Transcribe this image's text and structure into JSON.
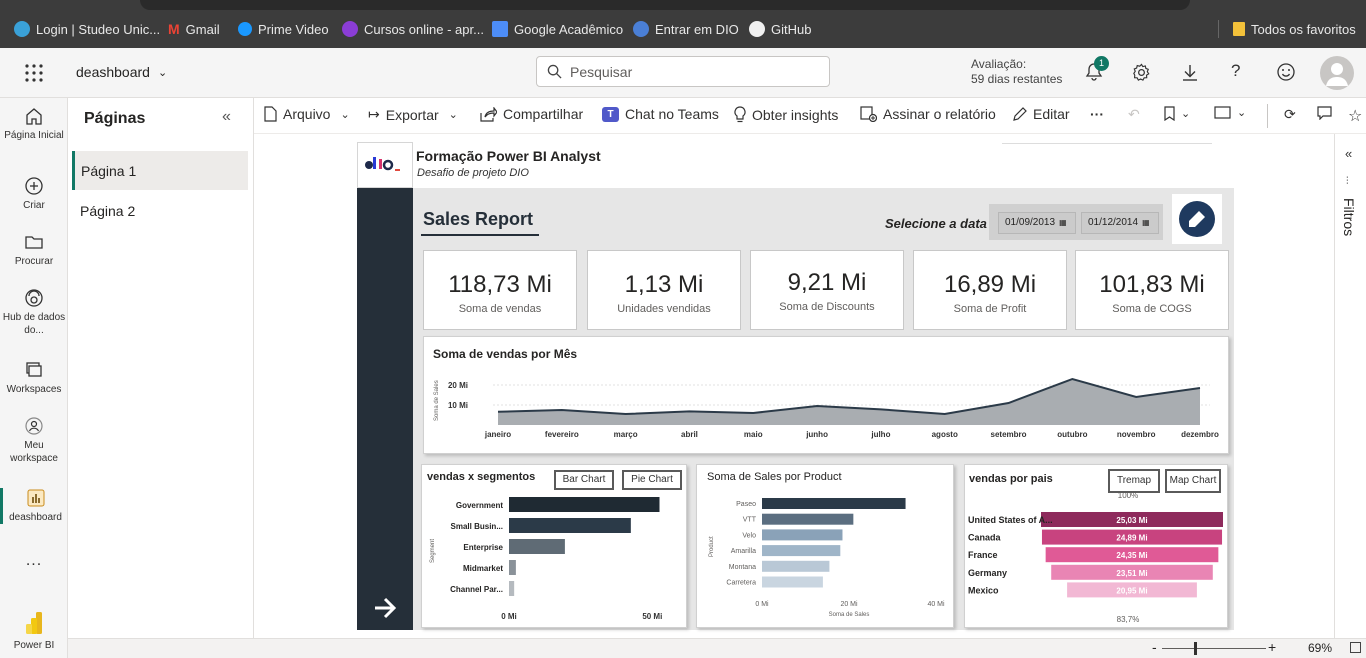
{
  "bookmarks": {
    "items": [
      "Login | Studeo Unic...",
      "Gmail",
      "Prime Video",
      "Cursos online - apr...",
      "Google Acadêmico",
      "Entrar em DIO",
      "GitHub"
    ],
    "favorites": "Todos os favoritos"
  },
  "header": {
    "report_name": "deashboard",
    "search_placeholder": "Pesquisar",
    "trial_line1": "Avaliação:",
    "trial_line2": "59 dias restantes",
    "notif_count": "1"
  },
  "nav": {
    "items": [
      "Página Inicial",
      "Criar",
      "Procurar",
      "Hub de dados do...",
      "Workspaces",
      "Meu workspace",
      "deashboard"
    ],
    "more": "...",
    "brand": "Power BI"
  },
  "pages": {
    "title": "Páginas",
    "items": [
      "Página 1",
      "Página 2"
    ]
  },
  "toolbar": {
    "arquivo": "Arquivo",
    "exportar": "Exportar",
    "compartilhar": "Compartilhar",
    "chat": "Chat no Teams",
    "insights": "Obter insights",
    "assinar": "Assinar o relatório",
    "editar": "Editar",
    "more": "···"
  },
  "filters": {
    "label": "Filtros"
  },
  "status": {
    "zoom": "69%",
    "minus": "-",
    "plus": "+"
  },
  "report": {
    "brand_title": "Formação Power BI Analyst",
    "brand_subtitle": "Desafio de projeto DIO",
    "title": "Sales Report",
    "date_label": "Selecione a data",
    "date_start": "01/09/2013",
    "date_end": "01/12/2014",
    "kpis": [
      {
        "value": "118,73 Mi",
        "label": "Soma de vendas"
      },
      {
        "value": "1,13 Mi",
        "label": "Unidades vendidas"
      },
      {
        "value": "9,21 Mi",
        "label": "Soma de Discounts"
      },
      {
        "value": "16,89 Mi",
        "label": "Soma de Profit"
      },
      {
        "value": "101,83 Mi",
        "label": "Soma de COGS"
      }
    ],
    "segments": {
      "bar_btn": "Bar Chart",
      "pie_btn": "Pie Chart"
    },
    "country": {
      "treemap_btn": "Tremap",
      "map_btn": "Map Chart"
    }
  },
  "chart_data": [
    {
      "type": "area",
      "title": "Soma de vendas por Mês",
      "ylabel": "Soma de Sales",
      "ytick_labels": [
        "10 Mi",
        "20 Mi"
      ],
      "ylim": [
        0,
        30
      ],
      "categories": [
        "janeiro",
        "fevereiro",
        "março",
        "abril",
        "maio",
        "junho",
        "julho",
        "agosto",
        "setembro",
        "outubro",
        "novembro",
        "dezembro"
      ],
      "values": [
        6.6,
        7.5,
        5.5,
        6.8,
        6.0,
        9.5,
        7.8,
        5.5,
        11.0,
        23.0,
        14.0,
        18.5
      ],
      "grid": true,
      "color": "#a9adb1",
      "line_color": "#2b3a48"
    },
    {
      "type": "bar",
      "orientation": "horizontal",
      "title": "vendas x segmentos",
      "ylabel": "Segment",
      "xtick_labels": [
        "0 Mi",
        "50 Mi"
      ],
      "xlim": [
        0,
        60
      ],
      "categories": [
        "Government",
        "Small Busin...",
        "Enterprise",
        "Midmarket",
        "Channel Par..."
      ],
      "values": [
        52.5,
        42.5,
        19.5,
        2.4,
        1.8
      ],
      "colors": [
        "#1f2a33",
        "#2b3a48",
        "#5f6b75",
        "#8a9299",
        "#b5babf"
      ]
    },
    {
      "type": "bar",
      "orientation": "horizontal",
      "title": "Soma de Sales por Product",
      "ylabel": "Product",
      "xlabel": "Soma de Sales",
      "xtick_labels": [
        "0 Mi",
        "20 Mi",
        "40 Mi"
      ],
      "xlim": [
        0,
        40
      ],
      "categories": [
        "Paseo",
        "VTT",
        "Velo",
        "Amarilla",
        "Montana",
        "Carretera"
      ],
      "values": [
        33.0,
        21.0,
        18.5,
        18.0,
        15.5,
        14.0
      ],
      "colors": [
        "#2b3a48",
        "#5b6e80",
        "#8aa2b8",
        "#9fb5c8",
        "#b9c8d6",
        "#c9d5e0"
      ]
    },
    {
      "type": "bar",
      "orientation": "funnel",
      "title": "vendas por pais",
      "categories": [
        "United States of A...",
        "Canada",
        "France",
        "Germany",
        "Mexico"
      ],
      "values": [
        25.03,
        24.89,
        24.35,
        23.51,
        20.95
      ],
      "value_labels": [
        "25,03 Mi",
        "24,89 Mi",
        "24,35 Mi",
        "23,51 Mi",
        "20,95 Mi"
      ],
      "top_pct": "100%",
      "bottom_pct": "83,7%",
      "colors": [
        "#8e2a5c",
        "#c8437f",
        "#e05a96",
        "#e985b4",
        "#f2b8d4"
      ]
    }
  ]
}
